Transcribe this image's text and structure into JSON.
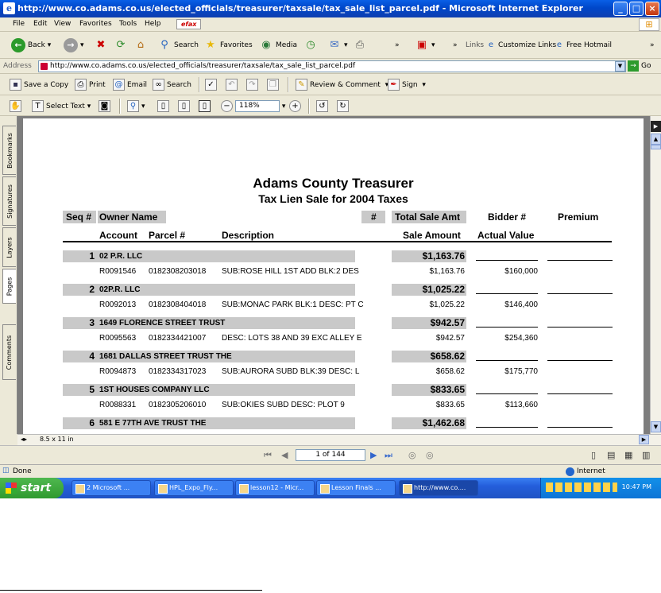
{
  "window": {
    "title": "http://www.co.adams.co.us/elected_officials/treasurer/taxsale/tax_sale_list_parcel.pdf - Microsoft Internet Explorer"
  },
  "menu": [
    "File",
    "Edit",
    "View",
    "Favorites",
    "Tools",
    "Help"
  ],
  "efax_label": "efax",
  "toolbar": {
    "back": "Back",
    "search": "Search",
    "favorites": "Favorites",
    "media": "Media",
    "links_label": "Links",
    "link1": "Customize Links",
    "link2": "Free Hotmail"
  },
  "address": {
    "label": "Address",
    "url": "http://www.co.adams.co.us/elected_officials/treasurer/taxsale/tax_sale_list_parcel.pdf",
    "go": "Go"
  },
  "adobe_toolbar": {
    "save": "Save a Copy",
    "print": "Print",
    "email": "Email",
    "search": "Search",
    "review": "Review & Comment",
    "sign": "Sign",
    "select_text": "Select Text",
    "zoom": "118%"
  },
  "side_tabs": [
    "Bookmarks",
    "Signatures",
    "Layers",
    "Pages",
    "Comments"
  ],
  "page_size": "8.5 x 11 in",
  "page_indicator": "1 of 144",
  "status": {
    "text": "Done",
    "zone": "Internet"
  },
  "taskbar": {
    "start": "start",
    "tasks": [
      "2 Microsoft ...",
      "HPL_Expo_Fly...",
      "lesson12 - Micr...",
      "Lesson Finals ...",
      "http://www.co...."
    ],
    "clock": "10:47 PM"
  },
  "report": {
    "title": "Adams County Treasurer",
    "subtitle": "Tax Lien Sale for 2004 Taxes",
    "headers": {
      "seq": "Seq #",
      "owner": "Owner Name",
      "num": "#",
      "total": "Total Sale Amt",
      "bidder": "Bidder #",
      "premium": "Premium",
      "account": "Account",
      "parcel": "Parcel #",
      "description": "Description",
      "sale_amount": "Sale Amount",
      "actual_value": "Actual Value"
    },
    "records": [
      {
        "seq": "1",
        "owner": "02 P.R. LLC",
        "total": "$1,163.76",
        "account": "R0091546",
        "parcel": "0182308203018",
        "description": "SUB:ROSE HILL 1ST ADD BLK:2 DES",
        "sale": "$1,163.76",
        "value": "$160,000"
      },
      {
        "seq": "2",
        "owner": "02P.R. LLC",
        "total": "$1,025.22",
        "account": "R0092013",
        "parcel": "0182308404018",
        "description": "SUB:MONAC PARK BLK:1 DESC: PT C",
        "sale": "$1,025.22",
        "value": "$146,400"
      },
      {
        "seq": "3",
        "owner": "1649 FLORENCE STREET TRUST",
        "total": "$942.57",
        "account": "R0095563",
        "parcel": "0182334421007",
        "description": "DESC: LOTS 38 AND 39 EXC ALLEY E",
        "sale": "$942.57",
        "value": "$254,360"
      },
      {
        "seq": "4",
        "owner": "1681 DALLAS STREET TRUST THE",
        "total": "$658.62",
        "account": "R0094873",
        "parcel": "0182334317023",
        "description": "SUB:AURORA SUBD BLK:39 DESC: L",
        "sale": "$658.62",
        "value": "$175,770"
      },
      {
        "seq": "5",
        "owner": "1ST HOUSES COMPANY LLC",
        "total": "$833.65",
        "account": "R0088331",
        "parcel": "0182305206010",
        "description": "SUB:OKIES SUBD DESC: PLOT 9",
        "sale": "$833.65",
        "value": "$113,660"
      },
      {
        "seq": "6",
        "owner": "581 E 77TH AVE TRUST THE",
        "total": "$1,462.68",
        "account": "",
        "parcel": "",
        "description": "",
        "sale": "",
        "value": ""
      }
    ]
  }
}
